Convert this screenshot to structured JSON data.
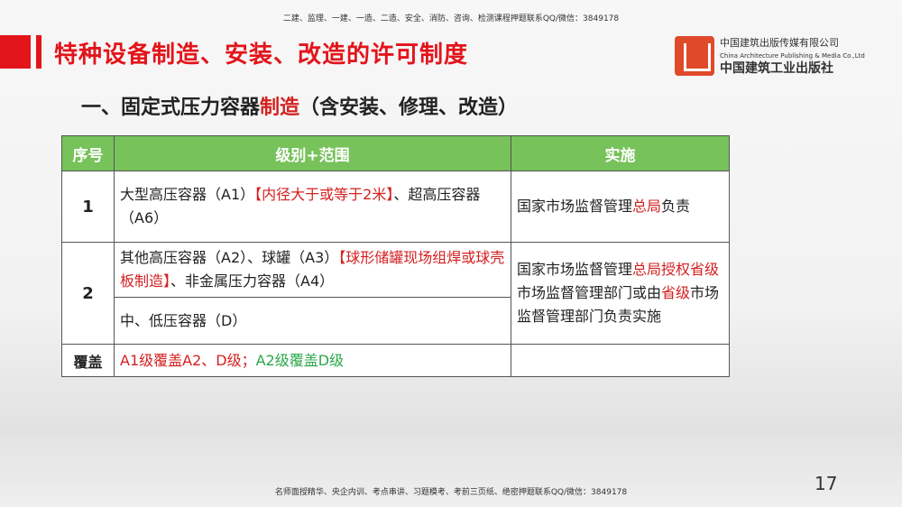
{
  "top_note": "二建、监理、一建、一造、二造、安全、消防、咨询、检测课程押题联系QQ/微信：3849178",
  "bottom_note": "名师面授精华、央企内训、考点串讲、习题模考、考前三页纸、绝密押题联系QQ/微信：3849178",
  "title": "特种设备制造、安装、改造的许可制度",
  "logo": {
    "cn": "中国建筑出版传媒有限公司",
    "en": "China Architecture Publishing & Media Co.,Ltd",
    "cn2": "中国建筑工业出版社"
  },
  "subtitle": {
    "part1": "一、固定式压力容器",
    "part2": "制造",
    "part3": "（含安装、修理、改造）"
  },
  "table": {
    "headers": [
      "序号",
      "级别+范围",
      "实施"
    ],
    "row1": {
      "no": "1",
      "scope_a": "大型高压容器（A1）",
      "scope_red": "【内径大于或等于2米】",
      "scope_b": "、超高压容器（A6）",
      "impl_a": "国家市场监督管理",
      "impl_red": "总局",
      "impl_b": "负责"
    },
    "row2": {
      "no": "2",
      "scope_a": "其他高压容器（A2）、球罐（A3）",
      "scope_red": "【球形储罐现场组焊或球壳板制造】",
      "scope_b": "、非金属压力容器（A4）",
      "scope_sub": "中、低压容器（D）",
      "impl_a": "国家市场监督管理",
      "impl_red1": "总局授权省级",
      "impl_b": "市场监督管理部门或由",
      "impl_red2": "省级",
      "impl_c": "市场监督管理部门负责实施"
    },
    "cover": {
      "label": "覆盖",
      "red": "A1级覆盖A2、D级；",
      "green": "A2级覆盖D级"
    }
  },
  "page_number": "17"
}
